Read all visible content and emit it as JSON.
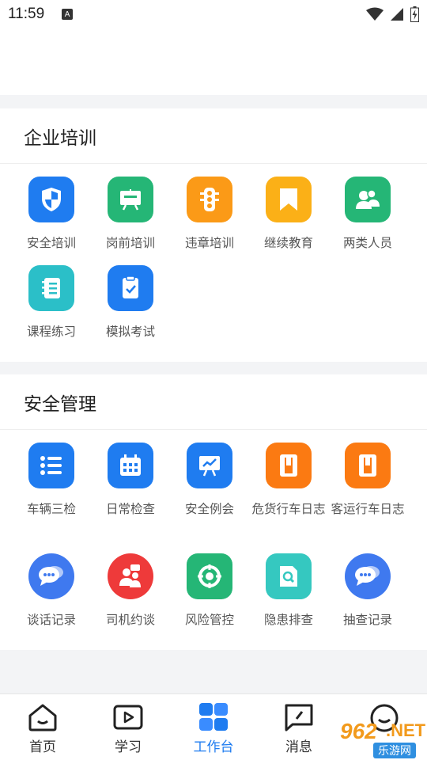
{
  "status": {
    "time": "11:59",
    "notification_icon": "A"
  },
  "sections": [
    {
      "title": "企业培训",
      "items": [
        {
          "label": "安全培训",
          "icon": "shield-icon",
          "color": "#1f7cf0"
        },
        {
          "label": "岗前培训",
          "icon": "chalkboard-icon",
          "color": "#25b676"
        },
        {
          "label": "违章培训",
          "icon": "traffic-light-icon",
          "color": "#fb9a17"
        },
        {
          "label": "继续教育",
          "icon": "bookmark-icon",
          "color": "#fbb017"
        },
        {
          "label": "两类人员",
          "icon": "people-icon",
          "color": "#25b676"
        },
        {
          "label": "课程练习",
          "icon": "notebook-icon",
          "color": "#2bbfc8"
        },
        {
          "label": "模拟考试",
          "icon": "exam-icon",
          "color": "#1f7cf0"
        }
      ]
    },
    {
      "title": "安全管理",
      "items": [
        {
          "label": "车辆三检",
          "icon": "list-icon",
          "color": "#1f7cf0"
        },
        {
          "label": "日常检查",
          "icon": "calendar-icon",
          "color": "#1f7cf0"
        },
        {
          "label": "安全例会",
          "icon": "presentation-icon",
          "color": "#1f7cf0"
        },
        {
          "label": "危货行车日志",
          "icon": "logbook-icon",
          "color": "#fb7a12"
        },
        {
          "label": "客运行车日志",
          "icon": "logbook-icon",
          "color": "#fb7a12"
        },
        {
          "label": "谈话记录",
          "icon": "chat-icon",
          "color": "#3f79ef"
        },
        {
          "label": "司机约谈",
          "icon": "meeting-icon",
          "color": "#ee3a3a"
        },
        {
          "label": "风险管控",
          "icon": "target-icon",
          "color": "#25b676"
        },
        {
          "label": "隐患排查",
          "icon": "search-doc-icon",
          "color": "#35c8c0"
        },
        {
          "label": "抽查记录",
          "icon": "chat-icon",
          "color": "#3f79ef"
        }
      ]
    }
  ],
  "tabs": [
    {
      "label": "首页",
      "icon": "home-icon",
      "active": false
    },
    {
      "label": "学习",
      "icon": "play-icon",
      "active": false
    },
    {
      "label": "工作台",
      "icon": "grid-icon",
      "active": true
    },
    {
      "label": "消息",
      "icon": "message-icon",
      "active": false
    },
    {
      "label": "",
      "icon": "profile-icon",
      "active": false
    }
  ],
  "watermark": {
    "number": "962",
    "suffix": ".NET",
    "site": "乐游网"
  },
  "colors": {
    "accent": "#1f7cf0",
    "background": "#f3f4f6"
  }
}
